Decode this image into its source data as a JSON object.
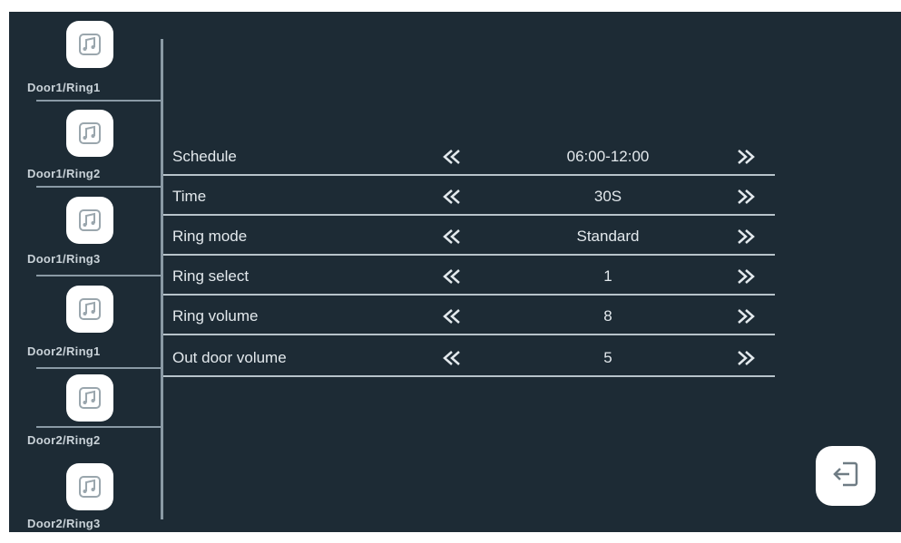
{
  "sidebar": {
    "items": [
      {
        "label": "Door1/Ring1",
        "icon": "music-note-icon"
      },
      {
        "label": "Door1/Ring2",
        "icon": "music-note-icon"
      },
      {
        "label": "Door1/Ring3",
        "icon": "music-note-icon"
      },
      {
        "label": "Door2/Ring1",
        "icon": "music-note-icon"
      },
      {
        "label": "Door2/Ring2",
        "icon": "music-note-icon"
      },
      {
        "label": "Door2/Ring3",
        "icon": "music-note-icon"
      }
    ]
  },
  "settings": {
    "rows": [
      {
        "label": "Schedule",
        "value": "06:00-12:00"
      },
      {
        "label": "Time",
        "value": "30S"
      },
      {
        "label": "Ring mode",
        "value": "Standard"
      },
      {
        "label": "Ring select",
        "value": "1"
      },
      {
        "label": "Ring volume",
        "value": "8"
      },
      {
        "label": "Out door volume",
        "value": "5"
      }
    ],
    "prev_icon": "double-chevron-left-icon",
    "next_icon": "double-chevron-right-icon"
  },
  "exit": {
    "icon": "exit-door-icon"
  },
  "colors": {
    "background": "#1d2b35",
    "text": "#e3e9ed",
    "divider": "#b7c3ca",
    "icon_tile": "#ffffff"
  }
}
